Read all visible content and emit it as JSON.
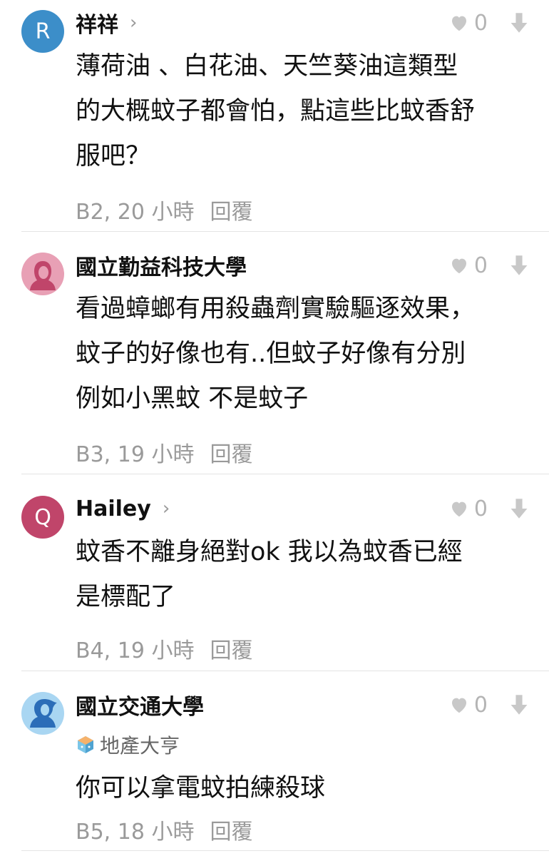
{
  "colors": {
    "avatar_r": "#3c8ec9",
    "avatar_q": "#c0456a",
    "avatar_pink_bg": "#e8a0b5",
    "avatar_blue_bg": "#a9d6f2",
    "muted": "#9a9a9a"
  },
  "comments": [
    {
      "avatar_letter": "R",
      "name": "祥祥",
      "chevron": "›",
      "likes": "0",
      "body": [
        "薄荷油 、白花油、天竺葵油這類型",
        "的大概蚊子都會怕，點這些比蚊香舒",
        "服吧？"
      ],
      "floor_time": "B2, 20 小時",
      "reply": "回覆"
    },
    {
      "name": "國立勤益科技大學",
      "likes": "0",
      "body": [
        "看過蟑螂有用殺蟲劑實驗驅逐效果，",
        "蚊子的好像也有..但蚊子好像有分別",
        "例如小黑蚊 不是蚊子"
      ],
      "floor_time": "B3, 19 小時",
      "reply": "回覆"
    },
    {
      "avatar_letter": "Q",
      "name": "Hailey",
      "chevron": "›",
      "likes": "0",
      "body": [
        "蚊香不離身絕對ok  我以為蚊香已經",
        "是標配了"
      ],
      "floor_time": "B4, 19 小時",
      "reply": "回覆"
    },
    {
      "name": "國立交通大學",
      "badge": "地產大亨",
      "likes": "0",
      "body": [
        "你可以拿電蚊拍練殺球"
      ],
      "floor_time": "B5, 18 小時",
      "reply": "回覆"
    }
  ]
}
